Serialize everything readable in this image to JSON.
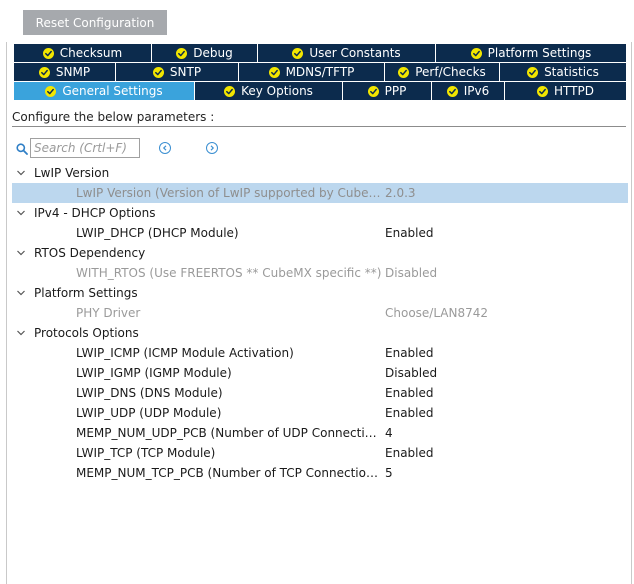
{
  "toolbar": {
    "reset_label": "Reset Configuration"
  },
  "tabs": {
    "row1": [
      {
        "label": "Checksum",
        "name": "checksum"
      },
      {
        "label": "Debug",
        "name": "debug"
      },
      {
        "label": "User Constants",
        "name": "user-constants"
      },
      {
        "label": "Platform Settings",
        "name": "platform-settings"
      }
    ],
    "row2": [
      {
        "label": "SNMP",
        "name": "snmp"
      },
      {
        "label": "SNTP",
        "name": "sntp"
      },
      {
        "label": "MDNS/TFTP",
        "name": "mdns-tftp"
      },
      {
        "label": "Perf/Checks",
        "name": "perf-checks"
      },
      {
        "label": "Statistics",
        "name": "statistics"
      }
    ],
    "row3": [
      {
        "label": "General Settings",
        "name": "general-settings",
        "active": true
      },
      {
        "label": "Key Options",
        "name": "key-options"
      },
      {
        "label": "PPP",
        "name": "ppp"
      },
      {
        "label": "IPv6",
        "name": "ipv6"
      },
      {
        "label": "HTTPD",
        "name": "httpd"
      }
    ]
  },
  "params": {
    "header": "Configure the below parameters :",
    "search_placeholder": "Search (Crtl+F)",
    "groups": [
      {
        "name": "LwIP Version",
        "rows": [
          {
            "name": "LwIP Version (Version of LwIP supported by CubeMX)",
            "value": "2.0.3",
            "state": "selected"
          }
        ]
      },
      {
        "name": "IPv4 - DHCP Options",
        "rows": [
          {
            "name": "LWIP_DHCP (DHCP Module)",
            "value": "Enabled",
            "state": "normal"
          }
        ]
      },
      {
        "name": "RTOS Dependency",
        "rows": [
          {
            "name": "WITH_RTOS (Use FREERTOS ** CubeMX specific **)",
            "value": "Disabled",
            "state": "disabled"
          }
        ]
      },
      {
        "name": "Platform Settings",
        "rows": [
          {
            "name": "PHY Driver",
            "value": "Choose/LAN8742",
            "state": "disabled"
          }
        ]
      },
      {
        "name": "Protocols Options",
        "rows": [
          {
            "name": "LWIP_ICMP (ICMP Module Activation)",
            "value": "Enabled",
            "state": "normal"
          },
          {
            "name": "LWIP_IGMP (IGMP Module)",
            "value": "Disabled",
            "state": "normal"
          },
          {
            "name": "LWIP_DNS (DNS Module)",
            "value": "Enabled",
            "state": "normal"
          },
          {
            "name": "LWIP_UDP (UDP Module)",
            "value": "Enabled",
            "state": "normal"
          },
          {
            "name": "MEMP_NUM_UDP_PCB (Number of UDP Connections)",
            "value": "4",
            "state": "normal"
          },
          {
            "name": "LWIP_TCP (TCP Module)",
            "value": "Enabled",
            "state": "normal"
          },
          {
            "name": "MEMP_NUM_TCP_PCB (Number of TCP Connections)",
            "value": "5",
            "state": "normal"
          }
        ]
      }
    ]
  },
  "colors": {
    "tab_bg": "#0c2b4d",
    "tab_active_bg": "#3aa3dc",
    "check_badge": "#f2e600",
    "row_selected": "#bcd7ee",
    "button_bg": "#a6a9ad"
  }
}
